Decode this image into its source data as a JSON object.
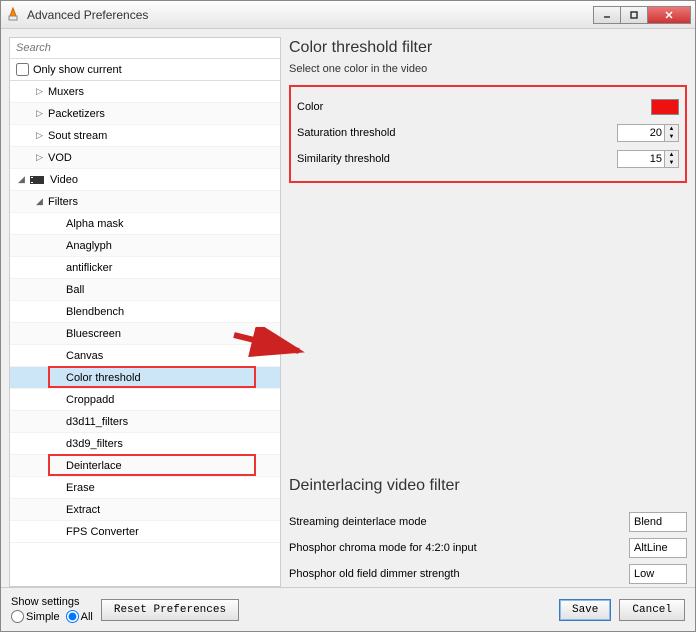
{
  "window": {
    "title": "Advanced Preferences"
  },
  "search": {
    "placeholder": "Search"
  },
  "only_current": {
    "label": "Only show current"
  },
  "tree": [
    {
      "depth": 1,
      "exp": "▷",
      "label": "Muxers"
    },
    {
      "depth": 1,
      "exp": "▷",
      "label": "Packetizers"
    },
    {
      "depth": 1,
      "exp": "▷",
      "label": "Sout stream"
    },
    {
      "depth": 1,
      "exp": "▷",
      "label": "VOD"
    },
    {
      "depth": 0,
      "exp": "◢",
      "label": "Video",
      "icon": true
    },
    {
      "depth": 1,
      "exp": "◢",
      "label": "Filters"
    },
    {
      "depth": 2,
      "exp": "",
      "label": "Alpha mask"
    },
    {
      "depth": 2,
      "exp": "",
      "label": "Anaglyph"
    },
    {
      "depth": 2,
      "exp": "",
      "label": "antiflicker"
    },
    {
      "depth": 2,
      "exp": "",
      "label": "Ball"
    },
    {
      "depth": 2,
      "exp": "",
      "label": "Blendbench"
    },
    {
      "depth": 2,
      "exp": "",
      "label": "Bluescreen"
    },
    {
      "depth": 2,
      "exp": "",
      "label": "Canvas"
    },
    {
      "depth": 2,
      "exp": "",
      "label": "Color threshold",
      "sel": true,
      "hl": true
    },
    {
      "depth": 2,
      "exp": "",
      "label": "Croppadd"
    },
    {
      "depth": 2,
      "exp": "",
      "label": "d3d11_filters"
    },
    {
      "depth": 2,
      "exp": "",
      "label": "d3d9_filters"
    },
    {
      "depth": 2,
      "exp": "",
      "label": "Deinterlace",
      "hl": true
    },
    {
      "depth": 2,
      "exp": "",
      "label": "Erase"
    },
    {
      "depth": 2,
      "exp": "",
      "label": "Extract"
    },
    {
      "depth": 2,
      "exp": "",
      "label": "FPS Converter"
    }
  ],
  "section1": {
    "title": "Color threshold filter",
    "subtitle": "Select one color in the video",
    "rows": {
      "color_label": "Color",
      "sat_label": "Saturation threshold",
      "sat_value": "20",
      "sim_label": "Similarity threshold",
      "sim_value": "15"
    }
  },
  "section2": {
    "title": "Deinterlacing video filter",
    "rows": {
      "mode_label": "Streaming deinterlace mode",
      "mode_value": "Blend",
      "chroma_label": "Phosphor chroma mode for 4:2:0 input",
      "chroma_value": "AltLine",
      "dimmer_label": "Phosphor old field dimmer strength",
      "dimmer_value": "Low"
    }
  },
  "footer": {
    "show_label": "Show settings",
    "simple": "Simple",
    "all": "All",
    "reset": "Reset Preferences",
    "save": "Save",
    "cancel": "Cancel"
  }
}
